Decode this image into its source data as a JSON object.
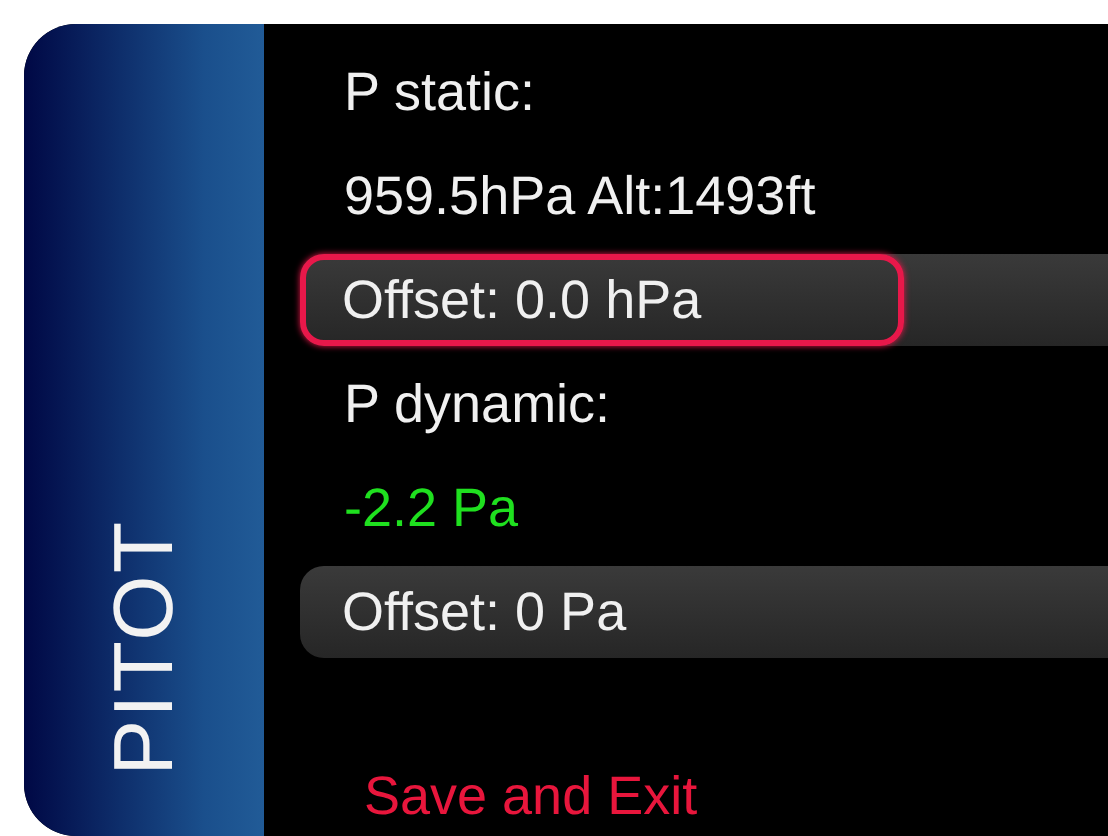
{
  "sidebar": {
    "title": "PITOT"
  },
  "items": [
    {
      "kind": "label",
      "text": "P static:"
    },
    {
      "kind": "reading",
      "text": "959.5hPa  Alt:1493ft"
    },
    {
      "kind": "field",
      "text": "Offset: 0.0 hPa",
      "selected": true
    },
    {
      "kind": "label",
      "text": "P dynamic:"
    },
    {
      "kind": "value",
      "text": "-2.2 Pa"
    },
    {
      "kind": "field",
      "text": "Offset: 0 Pa",
      "selected": false
    }
  ],
  "exit_button": {
    "label": "Save and Exit"
  }
}
